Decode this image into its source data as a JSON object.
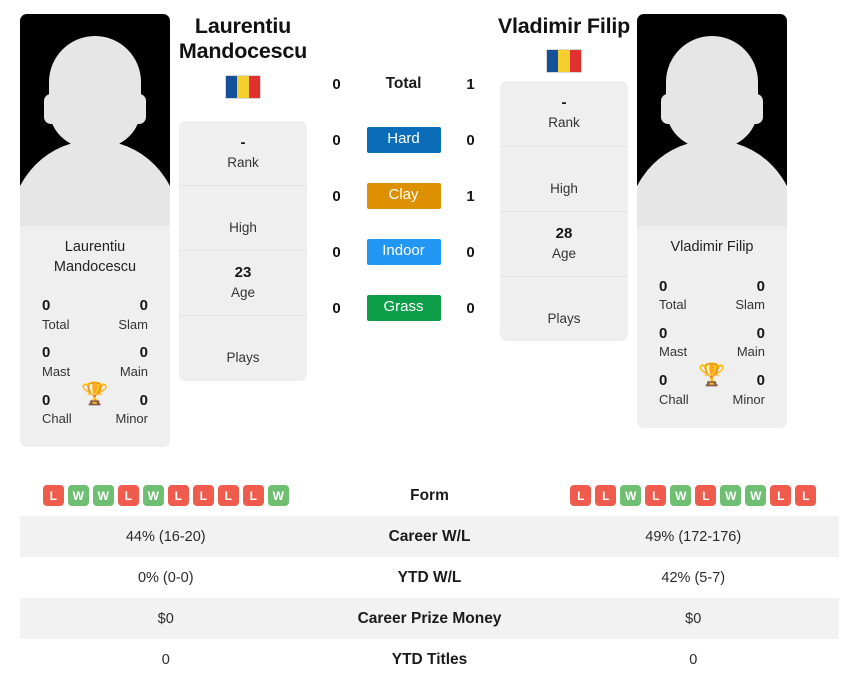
{
  "players": {
    "left": {
      "name": "Laurentiu Mandocescu",
      "photo_caption": "Laurentiu Mandocescu",
      "flag": "romania-flag",
      "info": [
        {
          "value": "-",
          "label": "Rank"
        },
        {
          "value": "",
          "label": "High"
        },
        {
          "value": "23",
          "label": "Age"
        },
        {
          "value": "",
          "label": "Plays"
        }
      ],
      "titles": [
        {
          "value": "0",
          "label": "Total"
        },
        {
          "value": "0",
          "label": "Slam"
        },
        {
          "value": "0",
          "label": "Mast"
        },
        {
          "value": "0",
          "label": "Main"
        },
        {
          "value": "0",
          "label": "Chall"
        },
        {
          "value": "0",
          "label": "Minor"
        }
      ],
      "form": [
        "L",
        "W",
        "W",
        "L",
        "W",
        "L",
        "L",
        "L",
        "L",
        "W"
      ],
      "career_wl": "44% (16-20)",
      "ytd_wl": "0% (0-0)",
      "career_prize_money": "$0",
      "ytd_titles": "0"
    },
    "right": {
      "name": "Vladimir Filip",
      "photo_caption": "Vladimir Filip",
      "flag": "romania-flag",
      "info": [
        {
          "value": "-",
          "label": "Rank"
        },
        {
          "value": "",
          "label": "High"
        },
        {
          "value": "28",
          "label": "Age"
        },
        {
          "value": "",
          "label": "Plays"
        }
      ],
      "titles": [
        {
          "value": "0",
          "label": "Total"
        },
        {
          "value": "0",
          "label": "Slam"
        },
        {
          "value": "0",
          "label": "Mast"
        },
        {
          "value": "0",
          "label": "Main"
        },
        {
          "value": "0",
          "label": "Chall"
        },
        {
          "value": "0",
          "label": "Minor"
        }
      ],
      "form": [
        "L",
        "L",
        "W",
        "L",
        "W",
        "L",
        "W",
        "W",
        "L",
        "L"
      ],
      "career_wl": "49% (172-176)",
      "ytd_wl": "42% (5-7)",
      "career_prize_money": "$0",
      "ytd_titles": "0"
    }
  },
  "h2h": {
    "rows": [
      {
        "label": "Total",
        "left": "0",
        "right": "1",
        "type": "plain",
        "color": ""
      },
      {
        "label": "Hard",
        "left": "0",
        "right": "0",
        "type": "surface",
        "color": "#0b6cb7"
      },
      {
        "label": "Clay",
        "left": "0",
        "right": "1",
        "type": "surface",
        "color": "#dd9000"
      },
      {
        "label": "Indoor",
        "left": "0",
        "right": "0",
        "type": "surface",
        "color": "#2196f3"
      },
      {
        "label": "Grass",
        "left": "0",
        "right": "0",
        "type": "surface",
        "color": "#0e9e4a"
      }
    ]
  },
  "stats_table": {
    "rows": [
      {
        "label": "Form",
        "kind": "form"
      },
      {
        "label": "Career W/L",
        "kind": "text",
        "key": "career_wl"
      },
      {
        "label": "YTD W/L",
        "kind": "text",
        "key": "ytd_wl"
      },
      {
        "label": "Career Prize Money",
        "kind": "text",
        "key": "career_prize_money"
      },
      {
        "label": "YTD Titles",
        "kind": "text",
        "key": "ytd_titles"
      }
    ]
  },
  "colors": {
    "win_badge": "#6fbf73",
    "loss_badge": "#ef5b4c",
    "flag_blue": "#16509b",
    "flag_yellow": "#f5d02c",
    "flag_red": "#e03030",
    "trophy": "#3b6fb5",
    "row_alt_bg": "#f2f2f2"
  },
  "icons": {
    "trophy": "trophy-icon",
    "flag": "flag-icon",
    "avatar": "player-avatar-silhouette"
  }
}
